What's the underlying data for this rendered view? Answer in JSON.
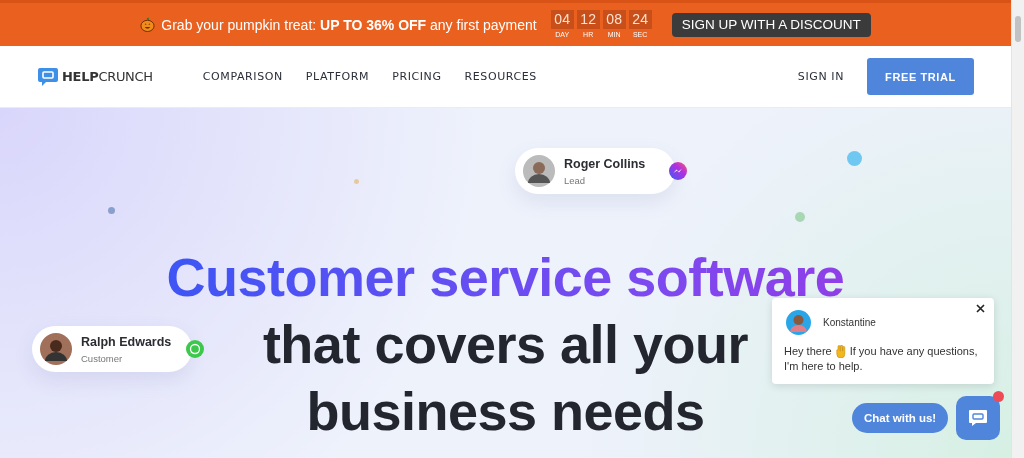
{
  "promo_banner": {
    "text": "Grab your pumpkin treat: **UP TO 36% OFF** any first payment",
    "countdown": [
      {
        "value": "04",
        "unit": "DAY"
      },
      {
        "value": "12",
        "unit": "HR"
      },
      {
        "value": "08",
        "unit": "MIN"
      },
      {
        "value": "24",
        "unit": "SEC"
      }
    ],
    "button": "SIGN UP WITH A DISCOUNT"
  },
  "nav": {
    "logo": {
      "bold": "HELP",
      "light": "CRUNCH"
    },
    "links": [
      "COMPARISON",
      "PLATFORM",
      "PRICING",
      "RESOURCES"
    ],
    "sign_in": "SIGN IN",
    "cta": "FREE TRIAL"
  },
  "hero": {
    "headline_gradient": "Customer service software",
    "headline_rest": [
      "that covers all your",
      "business needs"
    ],
    "contacts": [
      {
        "name": "Roger Collins",
        "role": "Lead",
        "kind": "messenger"
      },
      {
        "name": "Ralph Edwards",
        "role": "Customer",
        "kind": "whatsapp"
      }
    ]
  },
  "chat_widget": {
    "agent": "Konstantine",
    "greeting": "Hey there",
    "message_lines": [
      "If you have any questions,",
      "I'm here to help."
    ],
    "launcher_label": "Chat with us!",
    "unread": true
  }
}
